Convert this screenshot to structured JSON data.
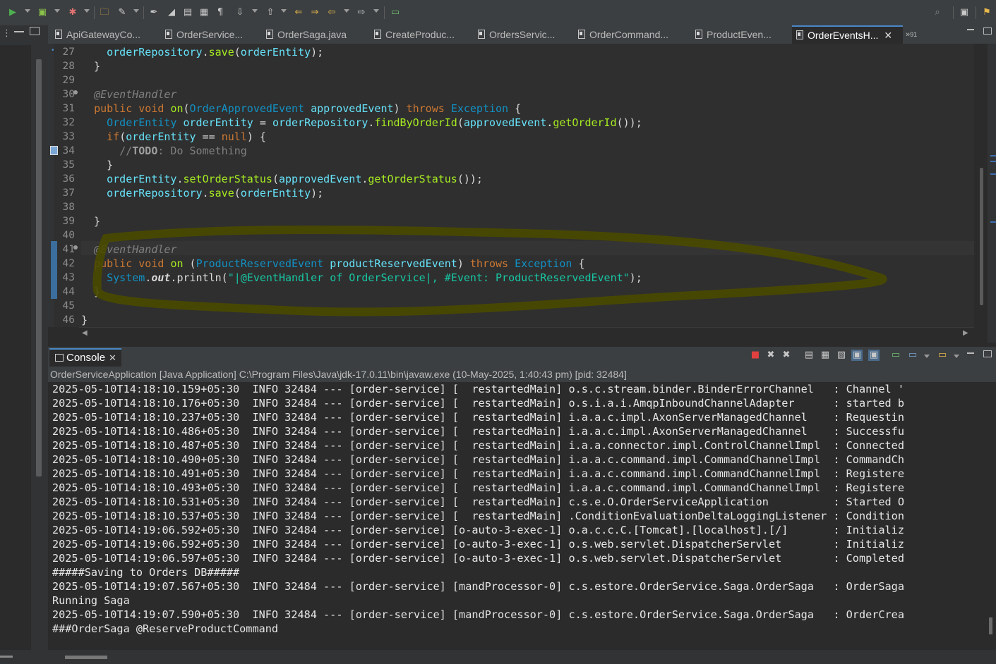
{
  "toolbar": {
    "icons": [
      "run-icon",
      "new-java-project-icon",
      "debug-icon",
      "open-folder-icon",
      "build-icon",
      "search-icon",
      "perspective-icon"
    ]
  },
  "tabs": [
    {
      "label": "ApiGatewayCo..."
    },
    {
      "label": "OrderService..."
    },
    {
      "label": "OrderSaga.java"
    },
    {
      "label": "CreateProduc..."
    },
    {
      "label": "OrdersServic..."
    },
    {
      "label": "OrderCommand..."
    },
    {
      "label": "ProductEven..."
    },
    {
      "label": "OrderEventsH..."
    }
  ],
  "tabs_overflow": "91",
  "editor": {
    "line_numbers": [
      "27",
      "28",
      "29",
      "30",
      "31",
      "32",
      "33",
      "34",
      "35",
      "36",
      "37",
      "38",
      "39",
      "40",
      "41",
      "42",
      "43",
      "44",
      "45",
      "46"
    ],
    "todo_keyword": "TODO",
    "println_string": "\"|@EventHandler of OrderService|, #Event: ProductReservedEvent\""
  },
  "console": {
    "tab_label": "Console",
    "description": "OrderServiceApplication [Java Application] C:\\Program Files\\Java\\jdk-17.0.11\\bin\\javaw.exe  (10-May-2025, 1:40:43 pm) [pid: 32484]",
    "lines": [
      "2025-05-10T14:18:10.159+05:30  INFO 32484 --- [order-service] [  restartedMain] o.s.c.stream.binder.BinderErrorChannel   : Channel '",
      "2025-05-10T14:18:10.176+05:30  INFO 32484 --- [order-service] [  restartedMain] o.s.i.a.i.AmqpInboundChannelAdapter      : started b",
      "2025-05-10T14:18:10.237+05:30  INFO 32484 --- [order-service] [  restartedMain] i.a.a.c.impl.AxonServerManagedChannel    : Requestin",
      "2025-05-10T14:18:10.486+05:30  INFO 32484 --- [order-service] [  restartedMain] i.a.a.c.impl.AxonServerManagedChannel    : Successfu",
      "2025-05-10T14:18:10.487+05:30  INFO 32484 --- [order-service] [  restartedMain] i.a.a.connector.impl.ControlChannelImpl  : Connected",
      "2025-05-10T14:18:10.490+05:30  INFO 32484 --- [order-service] [  restartedMain] i.a.a.c.command.impl.CommandChannelImpl  : CommandCh",
      "2025-05-10T14:18:10.491+05:30  INFO 32484 --- [order-service] [  restartedMain] i.a.a.c.command.impl.CommandChannelImpl  : Registere",
      "2025-05-10T14:18:10.493+05:30  INFO 32484 --- [order-service] [  restartedMain] i.a.a.c.command.impl.CommandChannelImpl  : Registere",
      "2025-05-10T14:18:10.531+05:30  INFO 32484 --- [order-service] [  restartedMain] c.s.e.O.OrderServiceApplication          : Started O",
      "2025-05-10T14:18:10.537+05:30  INFO 32484 --- [order-service] [  restartedMain] .ConditionEvaluationDeltaLoggingListener : Condition",
      "2025-05-10T14:19:06.592+05:30  INFO 32484 --- [order-service] [o-auto-3-exec-1] o.a.c.c.C.[Tomcat].[localhost].[/]       : Initializ",
      "2025-05-10T14:19:06.592+05:30  INFO 32484 --- [order-service] [o-auto-3-exec-1] o.s.web.servlet.DispatcherServlet        : Initializ",
      "2025-05-10T14:19:06.597+05:30  INFO 32484 --- [order-service] [o-auto-3-exec-1] o.s.web.servlet.DispatcherServlet        : Completed",
      "#####Saving to Orders DB#####",
      "2025-05-10T14:19:07.567+05:30  INFO 32484 --- [order-service] [mandProcessor-0] c.s.estore.OrderService.Saga.OrderSaga   : OrderSaga",
      "Running Saga",
      "2025-05-10T14:19:07.590+05:30  INFO 32484 --- [order-service] [mandProcessor-0] c.s.estore.OrderService.Saga.OrderSaga   : OrderCrea",
      "###OrderSaga @ReserveProductCommand"
    ]
  }
}
